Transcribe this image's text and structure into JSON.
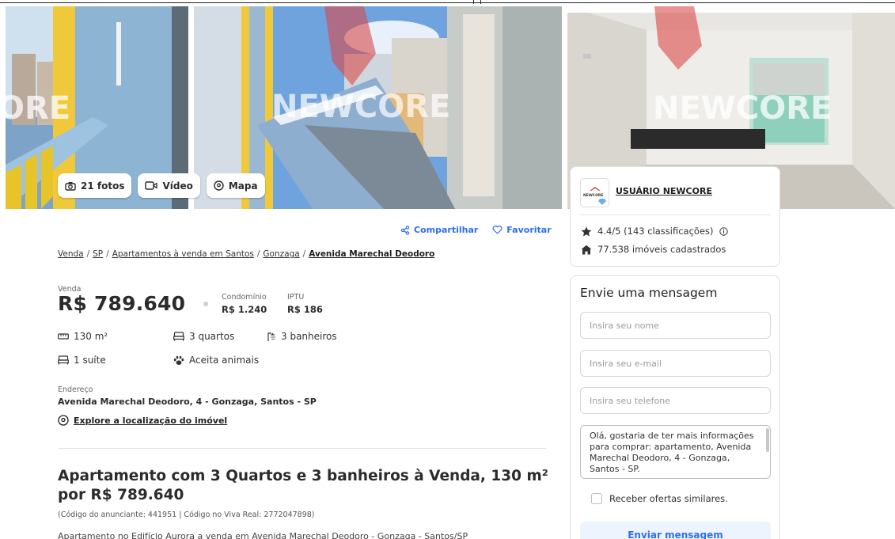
{
  "colors": {
    "accent": "#2d6ff0",
    "text": "#2b2b2b",
    "muted": "#666666",
    "border": "#dedede",
    "button_bg": "#eef4fe"
  },
  "gallery": {
    "watermark": "NEWCORE",
    "watermark_left": "ORE",
    "buttons": {
      "photos": {
        "label": "21 fotos",
        "icon": "camera-icon"
      },
      "video": {
        "label": "Vídeo",
        "icon": "video-icon"
      },
      "map": {
        "label": "Mapa",
        "icon": "map-pin-icon"
      }
    }
  },
  "actions": {
    "share": "Compartilhar",
    "favorite": "Favoritar"
  },
  "breadcrumb": {
    "items": [
      "Venda",
      "SP",
      "Apartamentos à venda em Santos",
      "Gonzaga"
    ],
    "current": "Avenida Marechal Deodoro"
  },
  "price": {
    "label": "Venda",
    "value": "R$ 789.640",
    "condo_label": "Condomínio",
    "condo_value": "R$ 1.240",
    "iptu_label": "IPTU",
    "iptu_value": "R$ 186"
  },
  "features": {
    "area": "130 m²",
    "bedrooms": "3 quartos",
    "bathrooms": "3 banheiros",
    "suites": "1 suíte",
    "pets": "Aceita animais"
  },
  "address": {
    "label": "Endereço",
    "value": "Avenida Marechal Deodoro, 4 - Gonzaga, Santos - SP",
    "explore": "Explore a localização do imóvel"
  },
  "listing": {
    "title": "Apartamento com 3 Quartos e 3 banheiros à Venda, 130 m² por R$ 789.640",
    "codes": "(Código do anunciante: 441951 | Código no Viva Real: 2772047898)",
    "description": "Apartamento no Edifício Aurora a venda em Avenida Marechal Deodoro - Gonzaga - Santos/SP"
  },
  "agent": {
    "logo_text": "NEWCORE",
    "name": "USUÁRIO NEWCORE",
    "rating": "4.4/5 (143 classificações)",
    "listings": "77.538 imóveis cadastrados"
  },
  "contact_form": {
    "title": "Envie uma mensagem",
    "name_placeholder": "Insira seu nome",
    "email_placeholder": "Insira seu e-mail",
    "phone_placeholder": "Insira seu telefone",
    "message": "Olá, gostaria de ter mais informações para comprar: apartamento, Avenida Marechal Deodoro, 4 - Gonzaga, Santos - SP.",
    "similar_offers": "Receber ofertas similares.",
    "submit": "Enviar mensagem"
  }
}
